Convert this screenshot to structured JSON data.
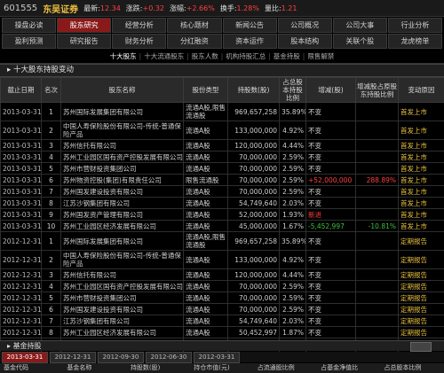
{
  "header": {
    "code": "601555",
    "name": "东吴证券",
    "fields": [
      {
        "label": "最新:",
        "value": "12.34"
      },
      {
        "label": "涨跌:",
        "value": "+0.32"
      },
      {
        "label": "涨幅:",
        "value": "+2.66%"
      },
      {
        "label": "换手:",
        "value": "1.28%"
      },
      {
        "label": "量比:",
        "value": "1.21"
      }
    ]
  },
  "nav": {
    "rows": [
      [
        "操盘必读",
        "股东研究",
        "经营分析",
        "核心题材",
        "新闻公告",
        "公司概况",
        "公司大事",
        "行业分析"
      ],
      [
        "盈利预测",
        "研究报告",
        "财务分析",
        "分红融资",
        "资本运作",
        "股本结构",
        "关联个股",
        "龙虎榜单"
      ]
    ],
    "active": "股东研究"
  },
  "subnav": {
    "items": [
      "十大股东",
      "十大流通股东",
      "股东人数",
      "机构持股汇总",
      "基金持股",
      "限售解禁"
    ],
    "active": "十大股东"
  },
  "section_title": "十大股东持股变动",
  "table": {
    "headers": [
      "截止日期",
      "名次",
      "股东名称",
      "股份类型",
      "持股数(股)",
      "占总股本持股比例",
      "增减(股)",
      "增减股占原股东持股比例",
      "变动原因"
    ],
    "rows": [
      {
        "date": "2013-03-31",
        "rank": "1",
        "name": "苏州国际发展集团有限公司",
        "type": "流通A股,限售流通股",
        "shares": "969,657,258",
        "ratio": "35.89%",
        "change": "不变",
        "change_ratio": "",
        "reason": "首发上市",
        "tall": true
      },
      {
        "date": "2013-03-31",
        "rank": "2",
        "name": "中国人寿保险股份有限公司-传统-普通保险产品",
        "type": "流通A股",
        "shares": "133,000,000",
        "ratio": "4.92%",
        "change": "不变",
        "change_ratio": "",
        "reason": "首发上市",
        "tall": true
      },
      {
        "date": "2013-03-31",
        "rank": "3",
        "name": "苏州信托有限公司",
        "type": "流通A股",
        "shares": "120,000,000",
        "ratio": "4.44%",
        "change": "不变",
        "change_ratio": "",
        "reason": "首发上市",
        "tall": false
      },
      {
        "date": "2013-03-31",
        "rank": "4",
        "name": "苏州工业园区国有资产控股发展有限公司",
        "type": "流通A股",
        "shares": "70,000,000",
        "ratio": "2.59%",
        "change": "不变",
        "change_ratio": "",
        "reason": "首发上市",
        "tall": false
      },
      {
        "date": "2013-03-31",
        "rank": "5",
        "name": "苏州市营财投资集团公司",
        "type": "流通A股",
        "shares": "70,000,000",
        "ratio": "2.59%",
        "change": "不变",
        "change_ratio": "",
        "reason": "首发上市",
        "tall": false
      },
      {
        "date": "2013-03-31",
        "rank": "6",
        "name": "苏州物资控股(集团)有限责任公司",
        "type": "限售流通股",
        "shares": "70,000,000",
        "ratio": "2.59%",
        "change": "+52,000,000",
        "change_ratio": "288.89%",
        "reason": "首发上市",
        "tall": false
      },
      {
        "date": "2013-03-31",
        "rank": "7",
        "name": "苏州国发建设投资有限公司",
        "type": "流通A股",
        "shares": "70,000,000",
        "ratio": "2.59%",
        "change": "不变",
        "change_ratio": "",
        "reason": "首发上市",
        "tall": false
      },
      {
        "date": "2013-03-31",
        "rank": "8",
        "name": "江苏沙钢集团有限公司",
        "type": "流通A股",
        "shares": "54,749,640",
        "ratio": "2.03%",
        "change": "不变",
        "change_ratio": "",
        "reason": "首发上市",
        "tall": false
      },
      {
        "date": "2013-03-31",
        "rank": "9",
        "name": "苏州国发资产管理有限公司",
        "type": "流通A股",
        "shares": "52,000,000",
        "ratio": "1.93%",
        "change": "新进",
        "change_ratio": "",
        "reason": "首发上市",
        "tall": false
      },
      {
        "date": "2013-03-31",
        "rank": "10",
        "name": "苏州工业园区经济发展有限公司",
        "type": "流通A股",
        "shares": "45,000,000",
        "ratio": "1.67%",
        "change": "-5,452,997",
        "change_ratio": "-10.81%",
        "reason": "首发上市",
        "tall": false
      },
      {
        "date": "2012-12-31",
        "rank": "1",
        "name": "苏州国际发展集团有限公司",
        "type": "流通A股,限售流通股",
        "shares": "969,657,258",
        "ratio": "35.89%",
        "change": "不变",
        "change_ratio": "",
        "reason": "定期报告",
        "tall": true
      },
      {
        "date": "2012-12-31",
        "rank": "2",
        "name": "中国人寿保险股份有限公司-传统-普通保险产品",
        "type": "流通A股",
        "shares": "133,000,000",
        "ratio": "4.92%",
        "change": "不变",
        "change_ratio": "",
        "reason": "定期报告",
        "tall": true
      },
      {
        "date": "2012-12-31",
        "rank": "3",
        "name": "苏州信托有限公司",
        "type": "流通A股",
        "shares": "120,000,000",
        "ratio": "4.44%",
        "change": "不变",
        "change_ratio": "",
        "reason": "定期报告",
        "tall": false
      },
      {
        "date": "2012-12-31",
        "rank": "4",
        "name": "苏州工业园区国有资产控股发展有限公司",
        "type": "流通A股",
        "shares": "70,000,000",
        "ratio": "2.59%",
        "change": "不变",
        "change_ratio": "",
        "reason": "定期报告",
        "tall": false
      },
      {
        "date": "2012-12-31",
        "rank": "5",
        "name": "苏州市营财投资集团公司",
        "type": "流通A股",
        "shares": "70,000,000",
        "ratio": "2.59%",
        "change": "不变",
        "change_ratio": "",
        "reason": "定期报告",
        "tall": false
      },
      {
        "date": "2012-12-31",
        "rank": "6",
        "name": "苏州国发建设投资有限公司",
        "type": "流通A股",
        "shares": "70,000,000",
        "ratio": "2.59%",
        "change": "不变",
        "change_ratio": "",
        "reason": "定期报告",
        "tall": false
      },
      {
        "date": "2012-12-31",
        "rank": "7",
        "name": "江苏沙钢集团有限公司",
        "type": "流通A股",
        "shares": "54,749,640",
        "ratio": "2.03%",
        "change": "不变",
        "change_ratio": "",
        "reason": "定期报告",
        "tall": false
      },
      {
        "date": "2012-12-31",
        "rank": "8",
        "name": "苏州工业园区经济发展有限公司",
        "type": "流通A股",
        "shares": "50,452,997",
        "ratio": "1.87%",
        "change": "不变",
        "change_ratio": "",
        "reason": "定期报告",
        "tall": false
      },
      {
        "date": "2012-12-31",
        "rank": "9",
        "name": "中国工商银行-华夏平稳增长混合型证券投资基金",
        "type": "流通A股",
        "shares": "19,583,770",
        "ratio": "0.72%",
        "change": "新进",
        "change_ratio": "",
        "reason": "定期报告",
        "tall": false
      },
      {
        "date": "2012-12-31",
        "rank": "10",
        "name": "苏州物资控股(集团)有限责任公司",
        "type": "流通A股",
        "shares": "18,000,000",
        "ratio": "0.67%",
        "change": "不变",
        "change_ratio": "",
        "reason": "定期报告",
        "tall": false
      }
    ]
  },
  "bottom": {
    "title": "基金持股",
    "tabs": [
      "2013-03-31",
      "2012-12-31",
      "2012-09-30",
      "2012-06-30",
      "2012-03-31"
    ],
    "active_tab": "2013-03-31",
    "columns": [
      "基金代码",
      "基金名称",
      "持股数(股)",
      "持仓市值(元)",
      "占流通股比例",
      "占基金净值比",
      "占总股本比例"
    ]
  }
}
